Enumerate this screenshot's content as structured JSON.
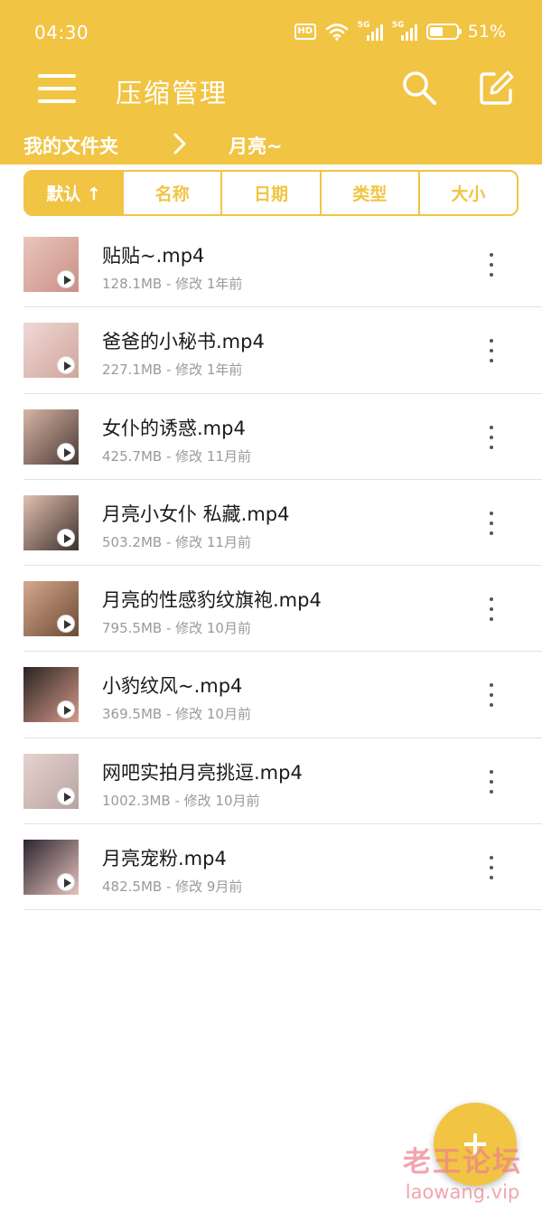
{
  "status_bar": {
    "time": "04:30",
    "hd_label": "HD",
    "signal1_label": "5G",
    "signal2_label": "5G",
    "battery_percent": "51%",
    "battery_level": 0.51
  },
  "toolbar": {
    "title": "压缩管理",
    "menu_icon": "hamburger-menu-icon",
    "search_icon": "search-icon",
    "edit_icon": "edit-icon"
  },
  "breadcrumb": {
    "root": "我的文件夹",
    "separator_icon": "chevron-right-icon",
    "current": "月亮~"
  },
  "sort_tabs": [
    {
      "label": "默认 ↑",
      "active": true
    },
    {
      "label": "名称",
      "active": false
    },
    {
      "label": "日期",
      "active": false
    },
    {
      "label": "类型",
      "active": false
    },
    {
      "label": "大小",
      "active": false
    }
  ],
  "files": [
    {
      "name": "贴贴~.mp4",
      "meta": "128.1MB - 修改 1年前",
      "thumb_colors": [
        "#e9c6bd",
        "#c98f86"
      ]
    },
    {
      "name": "爸爸的小秘书.mp4",
      "meta": "227.1MB - 修改 1年前",
      "thumb_colors": [
        "#f0d8d6",
        "#cfa59a"
      ]
    },
    {
      "name": "女仆的诱惑.mp4",
      "meta": "425.7MB - 修改 11月前",
      "thumb_colors": [
        "#d8b4a6",
        "#4a3a35"
      ]
    },
    {
      "name": "月亮小女仆 私藏.mp4",
      "meta": "503.2MB - 修改 11月前",
      "thumb_colors": [
        "#e2c0b0",
        "#3d302c"
      ]
    },
    {
      "name": "月亮的性感豹纹旗袍.mp4",
      "meta": "795.5MB - 修改 10月前",
      "thumb_colors": [
        "#d6a88f",
        "#6b4a32"
      ]
    },
    {
      "name": "小豹纹风~.mp4",
      "meta": "369.5MB - 修改 10月前",
      "thumb_colors": [
        "#2a2322",
        "#d59a88"
      ]
    },
    {
      "name": "网吧实拍月亮挑逗.mp4",
      "meta": "1002.3MB - 修改 10月前",
      "thumb_colors": [
        "#e6d3cf",
        "#b7a3a0"
      ]
    },
    {
      "name": "月亮宠粉.mp4",
      "meta": "482.5MB - 修改 9月前",
      "thumb_colors": [
        "#2b2530",
        "#e8c3bb"
      ]
    }
  ],
  "more_icon": "more-vertical-icon",
  "fab_icon": "plus-icon",
  "watermark": {
    "cn": "老王论坛",
    "en": "laowang.vip"
  },
  "colors": {
    "accent": "#F1C443",
    "text": "#1a1a1a",
    "meta": "#9a9a9a",
    "divider": "#e2e2e2"
  }
}
